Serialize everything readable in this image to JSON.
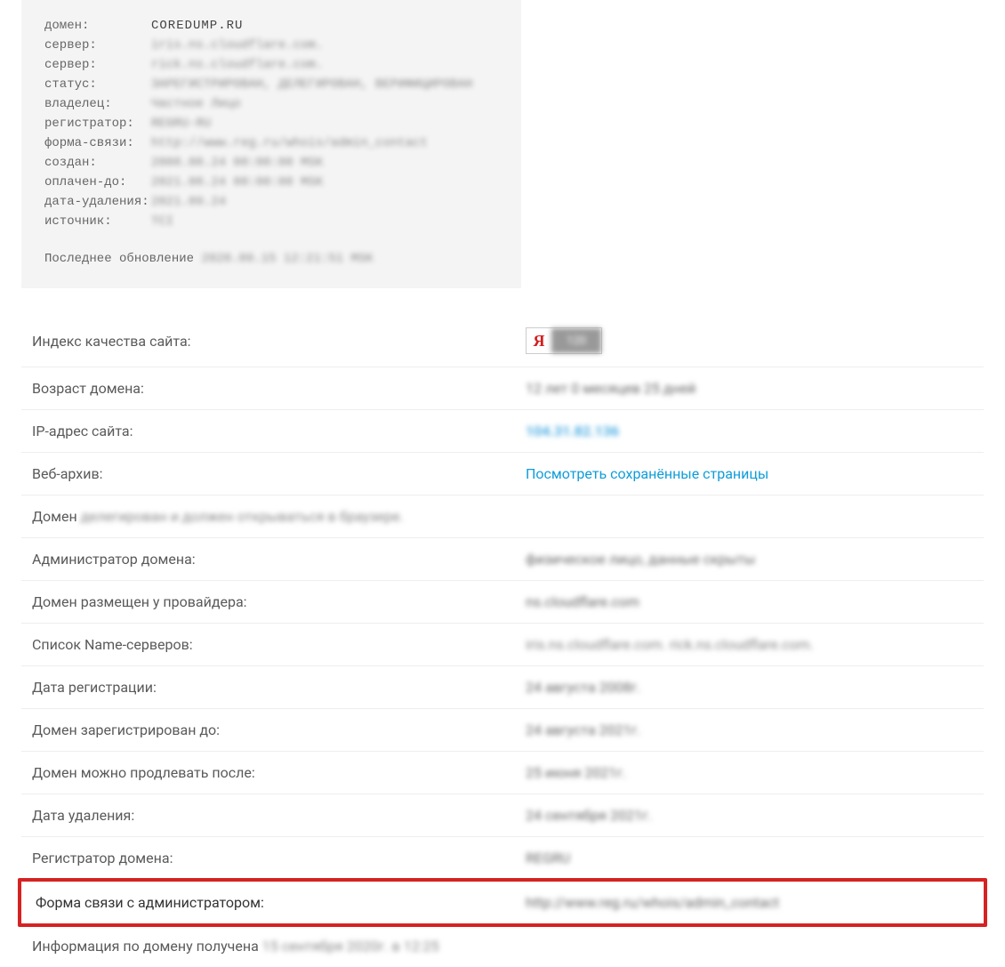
{
  "whois": {
    "domain_label": "домен:",
    "domain_value": "COREDUMP.RU",
    "server1_label": "сервер:",
    "server1_value": "iris.ns.cloudflare.com.",
    "server2_label": "сервер:",
    "server2_value": "rick.ns.cloudflare.com.",
    "status_label": "статус:",
    "status_value": "ЗАРЕГИСТРИРОВАН, ДЕЛЕГИРОВАН, ВЕРИФИЦИРОВАН",
    "owner_label": "владелец:",
    "owner_value": "Частное Лицо",
    "registrar_label": "регистратор:",
    "registrar_value": "REGRU-RU",
    "contact_label": "форма-связи:",
    "contact_value": "http://www.reg.ru/whois/admin_contact",
    "created_label": "создан:",
    "created_value": "2008.08.24 00:00:00 MSK",
    "paid_label": "оплачен-до:",
    "paid_value": "2021.08.24 00:00:00 MSK",
    "delete_label": "дата-удаления:",
    "delete_value": "2021.09.24",
    "source_label": "источник:",
    "source_value": "TCI",
    "footer_prefix": "Последнее обновление ",
    "footer_value": "2020.09.15 12:21:51 MSK"
  },
  "info": {
    "quality_label": "Индекс качества сайта:",
    "quality_badge_ya": "Я",
    "quality_badge_num": "120",
    "age_label": "Возраст домена:",
    "age_value": "12 лет 0 месяцев 25 дней",
    "ip_label": "IP-адрес сайта:",
    "ip_value": "104.31.82.136",
    "archive_label": "Веб-архив:",
    "archive_link": "Посмотреть сохранённые страницы",
    "domain_status_prefix": "Домен ",
    "domain_status_value": "делегирован и должен открываться в браузере.",
    "admin_label": "Администратор домена:",
    "admin_value": "физическое лицо, данные скрыты",
    "provider_label": "Домен размещен у провайдера:",
    "provider_value": "ns.cloudflare.com",
    "ns_label": "Список Name-серверов:",
    "ns_value1": "iris.ns.cloudflare.com.",
    "ns_value2": "rick.ns.cloudflare.com.",
    "regdate_label": "Дата регистрации:",
    "regdate_value": "24 августа 2008г.",
    "reguntil_label": "Домен зарегистрирован до:",
    "reguntil_value": "24 августа 2021г.",
    "renew_label": "Домен можно продлевать после:",
    "renew_value": "25 июня 2021г.",
    "deldate_label": "Дата удаления:",
    "deldate_value": "24 сентября 2021г.",
    "registrar_label": "Регистратор домена:",
    "registrar_value": "REGRU",
    "contactform_label": "Форма связи с администратором:",
    "contactform_value": "http://www.reg.ru/whois/admin_contact",
    "obtained_prefix": "Информация по домену получена ",
    "obtained_value": "15 сентября 2020г. в 12:25"
  }
}
